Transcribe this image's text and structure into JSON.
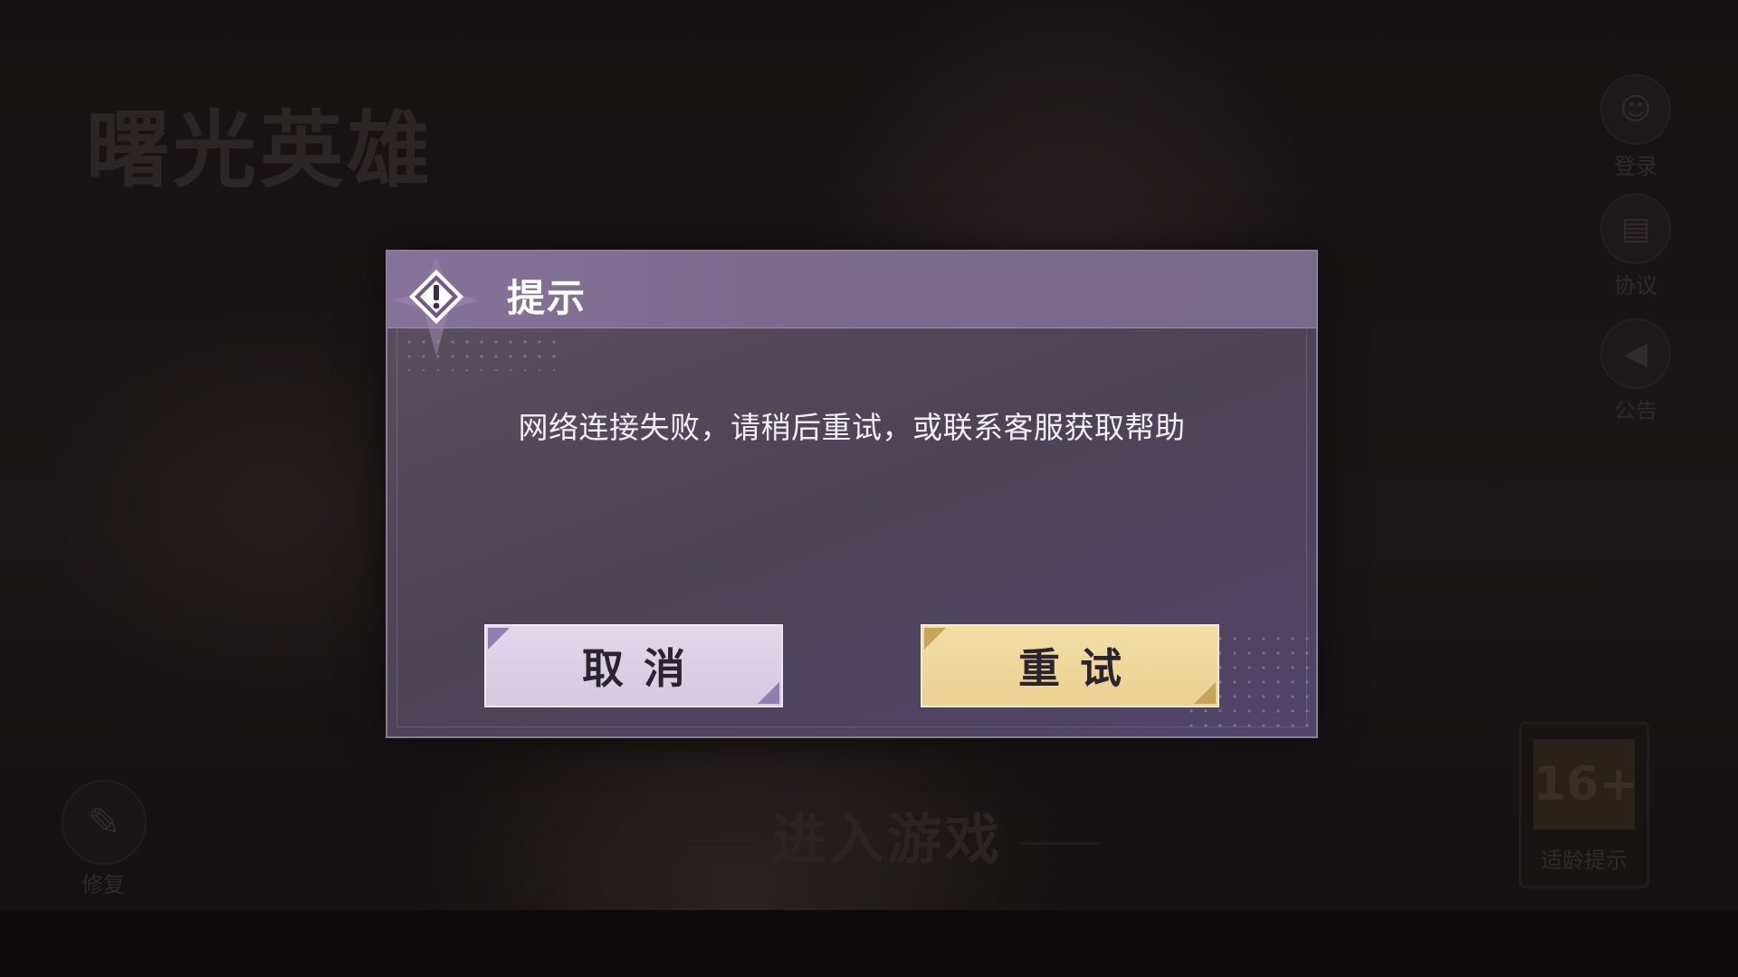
{
  "background": {
    "game_logo": "曙光英雄",
    "side_menu": [
      {
        "label": "登录",
        "icon": "user-icon"
      },
      {
        "label": "协议",
        "icon": "document-icon"
      },
      {
        "label": "公告",
        "icon": "megaphone-icon"
      }
    ],
    "repair_label": "修复",
    "enter_game_label": "进入游戏",
    "age_badge": {
      "number": "16+",
      "label": "适龄提示"
    }
  },
  "dialog": {
    "title": "提示",
    "message": "网络连接失败，请稍后重试，或联系客服获取帮助",
    "cancel_label": "取消",
    "retry_label": "重试"
  },
  "colors": {
    "dialog_header": "#7b6a8c",
    "dialog_body": "#4d4355",
    "cancel_button": "#d9cde6",
    "retry_button": "#edd79a"
  }
}
